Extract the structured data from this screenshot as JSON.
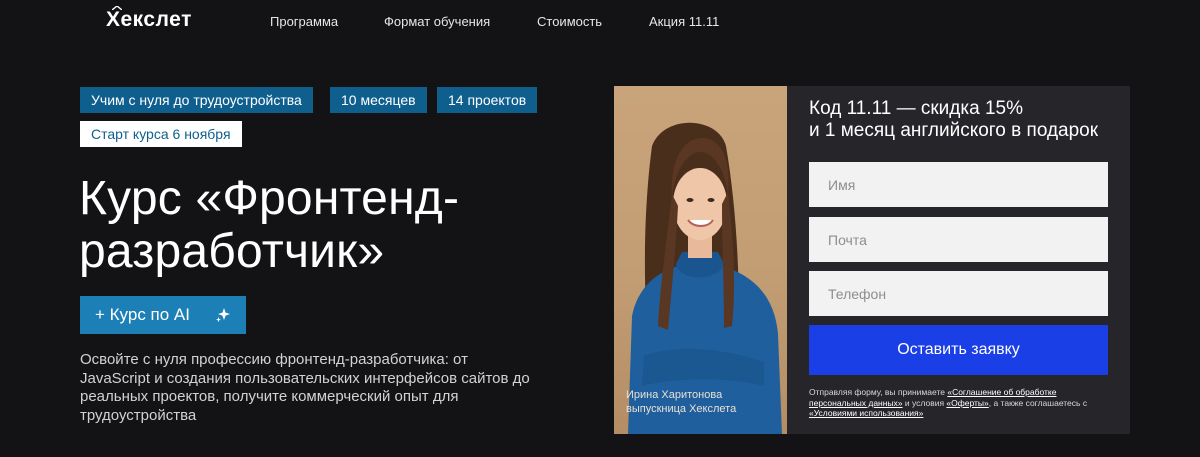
{
  "header": {
    "logo": "Хекслет",
    "nav": [
      "Программа",
      "Формат обучения",
      "Стоимость",
      "Акция 11.11"
    ]
  },
  "tags": [
    "Учим с нуля до трудоустройства",
    "10 месяцев",
    "14 проектов"
  ],
  "start_tag": "Старт курса 6 ноября",
  "title_line1": "Курс «Фронтенд-",
  "title_line2": "разработчик»",
  "ai_button": "+ Курс по AI",
  "description": "Освойте с нуля профессию фронтенд-разработчика: от JavaScript и создания пользовательских интерфейсов сайтов до реальных проектов, получите коммерческий опыт для трудоустройства",
  "photo": {
    "name": "Ирина Харитонова",
    "role": "выпускница Хекслета"
  },
  "form": {
    "title_line1": "Код 11.11 — скидка 15%",
    "title_line2": "и 1 месяц английского в подарок",
    "name_placeholder": "Имя",
    "email_placeholder": "Почта",
    "phone_placeholder": "Телефон",
    "submit": "Оставить заявку",
    "legal": {
      "part1": "Отправляя форму, вы принимаете ",
      "link1": "«Соглашение об обработке персональных данных»",
      "part2": " и условия ",
      "link2": "«Оферты»",
      "part3": ", а также соглашаетесь с ",
      "link3": "«Условиями использования»"
    }
  },
  "colors": {
    "background": "#131316",
    "tag_blue": "#0f5f8e",
    "ai_button": "#1c7fb5",
    "panel": "#26262a",
    "submit": "#1b3fe6"
  }
}
